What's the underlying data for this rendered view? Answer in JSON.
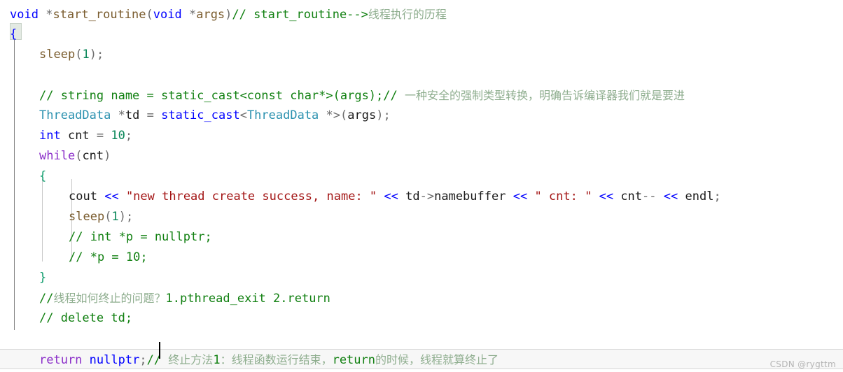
{
  "editor": {
    "language": "cpp",
    "colors": {
      "background": "#ffffff",
      "keyword_blue": "#0000ff",
      "keyword_purple": "#8b2fc9",
      "type_teal": "#2b91af",
      "function_brown": "#7a5c2e",
      "comment_green": "#118011",
      "comment_cjk": "#8fae8f",
      "string_red": "#a31515",
      "number_green": "#098658",
      "punctuation_gray": "#6d6d6d",
      "brace_green": "#0b9b6a",
      "current_line_bg": "#f7f7f7",
      "indent_guide": "#808080",
      "watermark": "#b4b4b4"
    },
    "caret": {
      "line": 16,
      "after_text": "nullptr"
    },
    "bracket_match": {
      "line": 2,
      "char": "{"
    },
    "current_line_index": 16,
    "lines": [
      {
        "n": 1,
        "indent": 0,
        "tokens": [
          {
            "t": "void",
            "c": "kw"
          },
          {
            "t": " ",
            "c": "plain"
          },
          {
            "t": "*",
            "c": "punct"
          },
          {
            "t": "start_routine",
            "c": "fn"
          },
          {
            "t": "(",
            "c": "punct"
          },
          {
            "t": "void",
            "c": "kw"
          },
          {
            "t": " ",
            "c": "plain"
          },
          {
            "t": "*",
            "c": "punct"
          },
          {
            "t": "args",
            "c": "fn"
          },
          {
            "t": ")",
            "c": "punct"
          },
          {
            "t": "// start_routine-->",
            "c": "cmt"
          },
          {
            "t": "线程执行的历程",
            "c": "cmt-cn cjk"
          }
        ]
      },
      {
        "n": 2,
        "indent": 0,
        "tokens": [
          {
            "t": "{",
            "c": "brace-b"
          }
        ]
      },
      {
        "n": 3,
        "indent": 1,
        "tokens": [
          {
            "t": "sleep",
            "c": "fn"
          },
          {
            "t": "(",
            "c": "punct"
          },
          {
            "t": "1",
            "c": "num"
          },
          {
            "t": ")",
            "c": "punct"
          },
          {
            "t": ";",
            "c": "punct"
          }
        ]
      },
      {
        "n": 4,
        "indent": 1,
        "tokens": []
      },
      {
        "n": 5,
        "indent": 1,
        "tokens": [
          {
            "t": "// string name = static_cast<const char*>(args);// ",
            "c": "cmt"
          },
          {
            "t": "一种安全的强制类型转换，明确告诉编译器我们就是要进",
            "c": "cmt-cn cjk"
          }
        ]
      },
      {
        "n": 6,
        "indent": 1,
        "tokens": [
          {
            "t": "ThreadData",
            "c": "type"
          },
          {
            "t": " ",
            "c": "plain"
          },
          {
            "t": "*",
            "c": "punct"
          },
          {
            "t": "td",
            "c": "plain"
          },
          {
            "t": " ",
            "c": "plain"
          },
          {
            "t": "=",
            "c": "punct"
          },
          {
            "t": " ",
            "c": "plain"
          },
          {
            "t": "static_cast",
            "c": "kw"
          },
          {
            "t": "<",
            "c": "punct"
          },
          {
            "t": "ThreadData",
            "c": "type"
          },
          {
            "t": " ",
            "c": "plain"
          },
          {
            "t": "*",
            "c": "punct"
          },
          {
            "t": ">",
            "c": "punct"
          },
          {
            "t": "(",
            "c": "punct"
          },
          {
            "t": "args",
            "c": "plain"
          },
          {
            "t": ")",
            "c": "punct"
          },
          {
            "t": ";",
            "c": "punct"
          }
        ]
      },
      {
        "n": 7,
        "indent": 1,
        "tokens": [
          {
            "t": "int",
            "c": "kw"
          },
          {
            "t": " cnt ",
            "c": "plain"
          },
          {
            "t": "=",
            "c": "punct"
          },
          {
            "t": " ",
            "c": "plain"
          },
          {
            "t": "10",
            "c": "num"
          },
          {
            "t": ";",
            "c": "punct"
          }
        ]
      },
      {
        "n": 8,
        "indent": 1,
        "tokens": [
          {
            "t": "while",
            "c": "kw2"
          },
          {
            "t": "(",
            "c": "punct"
          },
          {
            "t": "cnt",
            "c": "plain"
          },
          {
            "t": ")",
            "c": "punct"
          }
        ]
      },
      {
        "n": 9,
        "indent": 1,
        "tokens": [
          {
            "t": "{",
            "c": "brace"
          }
        ]
      },
      {
        "n": 10,
        "indent": 2,
        "tokens": [
          {
            "t": "cout",
            "c": "plain"
          },
          {
            "t": " ",
            "c": "plain"
          },
          {
            "t": "<<",
            "c": "op"
          },
          {
            "t": " ",
            "c": "plain"
          },
          {
            "t": "\"new thread create success, name: \"",
            "c": "str"
          },
          {
            "t": " ",
            "c": "plain"
          },
          {
            "t": "<<",
            "c": "op"
          },
          {
            "t": " td",
            "c": "plain"
          },
          {
            "t": "->",
            "c": "punct"
          },
          {
            "t": "namebuffer",
            "c": "plain"
          },
          {
            "t": " ",
            "c": "plain"
          },
          {
            "t": "<<",
            "c": "op"
          },
          {
            "t": " ",
            "c": "plain"
          },
          {
            "t": "\" cnt: \"",
            "c": "str"
          },
          {
            "t": " ",
            "c": "plain"
          },
          {
            "t": "<<",
            "c": "op"
          },
          {
            "t": " cnt",
            "c": "plain"
          },
          {
            "t": "--",
            "c": "punct"
          },
          {
            "t": " ",
            "c": "plain"
          },
          {
            "t": "<<",
            "c": "op"
          },
          {
            "t": " endl",
            "c": "plain"
          },
          {
            "t": ";",
            "c": "punct"
          }
        ]
      },
      {
        "n": 11,
        "indent": 2,
        "tokens": [
          {
            "t": "sleep",
            "c": "fn"
          },
          {
            "t": "(",
            "c": "punct"
          },
          {
            "t": "1",
            "c": "num"
          },
          {
            "t": ")",
            "c": "punct"
          },
          {
            "t": ";",
            "c": "punct"
          }
        ]
      },
      {
        "n": 12,
        "indent": 2,
        "tokens": [
          {
            "t": "// int *p = nullptr;",
            "c": "cmt"
          }
        ]
      },
      {
        "n": 13,
        "indent": 2,
        "tokens": [
          {
            "t": "// *p = 10;",
            "c": "cmt"
          }
        ]
      },
      {
        "n": 14,
        "indent": 1,
        "tokens": [
          {
            "t": "}",
            "c": "brace"
          }
        ]
      },
      {
        "n": 15,
        "indent": 1,
        "tokens": [
          {
            "t": "//",
            "c": "cmt"
          },
          {
            "t": "线程如何终止的问题？",
            "c": "cmt-cn cjk"
          },
          {
            "t": "1.pthread_exit 2.return",
            "c": "cmt"
          }
        ]
      },
      {
        "n": 16,
        "indent": 1,
        "tokens": [
          {
            "t": "// delete td;",
            "c": "cmt"
          }
        ]
      },
      {
        "n": 17,
        "indent": 1,
        "tokens": []
      },
      {
        "n": 18,
        "indent": 1,
        "tokens": [
          {
            "t": "return",
            "c": "kw2"
          },
          {
            "t": " ",
            "c": "plain"
          },
          {
            "t": "nullptr",
            "c": "kw"
          },
          {
            "t": ";",
            "c": "punct"
          },
          {
            "t": "// ",
            "c": "cmt"
          },
          {
            "t": "终止方法",
            "c": "cmt-cn cjk"
          },
          {
            "t": "1",
            "c": "cmt"
          },
          {
            "t": "：线程函数运行结束，",
            "c": "cmt-cn cjk"
          },
          {
            "t": "return",
            "c": "cmt"
          },
          {
            "t": "的时候，线程就算终止了",
            "c": "cmt-cn cjk"
          }
        ]
      }
    ]
  },
  "watermark": {
    "text": "CSDN @rygttm"
  }
}
